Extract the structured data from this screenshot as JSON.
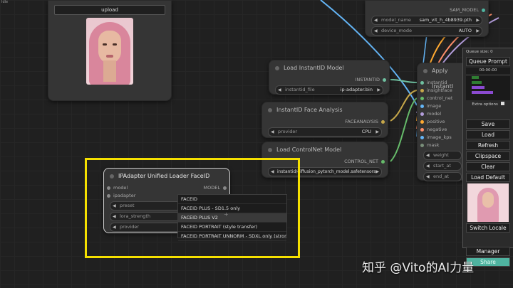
{
  "top_menu_label": "Idle",
  "load_image_node": {
    "upload_label": "upload"
  },
  "sam_node": {
    "output": "SAM_MODEL",
    "model_name_label": "model_name",
    "model_name_value": "sam_vit_h_4b8939.pth",
    "device_mode_label": "device_mode",
    "device_mode_value": "AUTO"
  },
  "load_instantid_node": {
    "title": "Load InstantID Model",
    "output": "INSTANTID",
    "file_label": "instantid_file",
    "file_value": "ip-adapter.bin"
  },
  "face_analysis_node": {
    "title": "InstantID Face Analysis",
    "output": "FACEANALYSIS",
    "provider_label": "provider",
    "provider_value": "CPU"
  },
  "controlnet_node": {
    "title": "Load ControlNet Model",
    "output": "CONTROL_NET",
    "file_value": "instantid/diffusion_pytorch_model.safetensors"
  },
  "apply_instantid_node": {
    "title": "Apply InstantI",
    "inputs": [
      "instantid",
      "insightface",
      "control_net",
      "image",
      "model",
      "positive",
      "negative",
      "image_kps",
      "mask"
    ],
    "widgets": [
      "weight",
      "start_at",
      "end_at"
    ]
  },
  "ipadapter_node": {
    "title": "IPAdapter Unified Loader FaceID",
    "inputs": [
      "model",
      "ipadapter"
    ],
    "output": "MODEL",
    "widgets": [
      "preset",
      "lora_strength",
      "provider"
    ]
  },
  "preset_dropdown": {
    "options": [
      "FACEID",
      "FACEID PLUS - SD1.5 only",
      "FACEID PLUS V2",
      "FACEID PORTRAIT (style transfer)",
      "FACEID PORTRAIT UNNORM - SDXL only (strong)"
    ],
    "selected_index": 2
  },
  "queue_panel": {
    "queue_size": "Queue size: 0",
    "queue_prompt": "Queue Prompt",
    "timer": "00:00:00",
    "extra_options": "Extra options",
    "buttons": [
      "Save",
      "Load",
      "Refresh",
      "Clipspace",
      "Clear",
      "Load Default"
    ],
    "switch_locale": "Switch Locale",
    "manager": "Manager",
    "share": "Share"
  },
  "watermark": "知乎 @Vito的AI力量",
  "colors": {
    "instantid": "#6fc0a0",
    "model": "#b39ddb",
    "conditioning": "#ffa931",
    "image": "#64b5f6",
    "control": "#66bb6a",
    "highlight_box": "#f5e000",
    "share_button": "#4fb3a0"
  }
}
